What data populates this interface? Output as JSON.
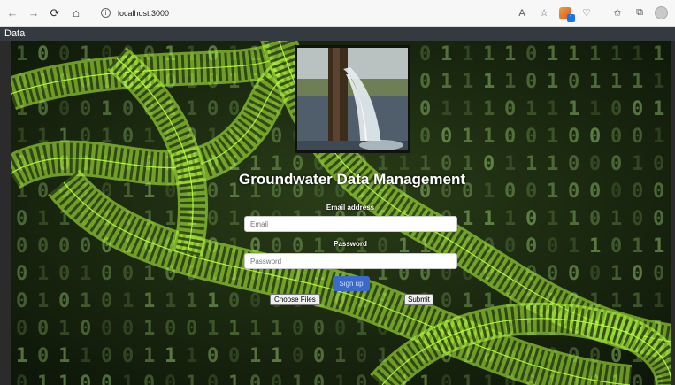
{
  "browser": {
    "url": "localhost:3000",
    "nav_icons": [
      "back-arrow-icon",
      "forward-arrow-icon",
      "refresh-icon",
      "home-icon"
    ],
    "toolbar_icons": [
      "read-aloud-icon",
      "favorite-star-icon",
      "extension-icon",
      "browser-essentials-icon",
      "favorites-icon",
      "collections-icon",
      "profile-avatar"
    ]
  },
  "navbar": {
    "brand": "Data"
  },
  "hero": {
    "image": "water-pipe-stream-photo"
  },
  "form": {
    "title": "Groundwater Data Management",
    "email_label": "Email address",
    "email_placeholder": "Email",
    "password_label": "Password",
    "password_placeholder": "Password",
    "signup_label": "Sign up",
    "choose_files_label": "Choose Files",
    "submit_label": "Submit"
  },
  "theme": {
    "navbar_bg": "#343a40",
    "background_dark": "#1b2a12",
    "matrix_green": "#b8ff3c",
    "primary_button": "#3b6ac9"
  }
}
